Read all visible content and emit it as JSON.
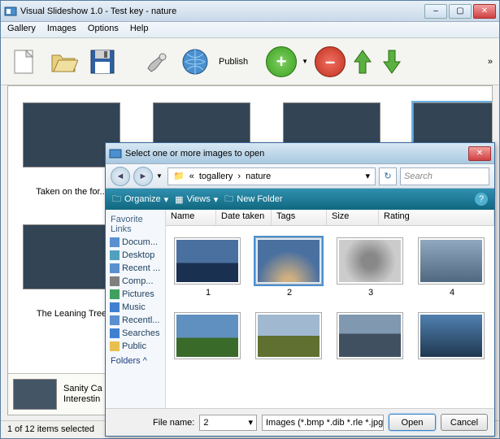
{
  "main": {
    "title": "Visual Slideshow 1.0 - Test key - nature",
    "menu": [
      "Gallery",
      "Images",
      "Options",
      "Help"
    ],
    "publish_label": "Publish",
    "thumbs": [
      {
        "caption": "Taken on the for..."
      },
      {
        "caption": ""
      },
      {
        "caption": ""
      },
      {
        "caption": ""
      }
    ],
    "second_caption": "The Leaning Tree",
    "selected_caption_1": "Sanity Ca",
    "selected_caption_2": "Interestin",
    "status": "1 of 12 items selected"
  },
  "dlg": {
    "title": "Select one or more images to open",
    "crumbs": [
      "«",
      "togallery",
      "›",
      "nature"
    ],
    "search_placeholder": "Search",
    "cmd": {
      "organize": "Organize",
      "views": "Views",
      "newfolder": "New Folder"
    },
    "favs_header": "Favorite Links",
    "favs": [
      "Docum...",
      "Desktop",
      "Recent ...",
      "Comp...",
      "Pictures",
      "Music",
      "Recentl...",
      "Searches",
      "Public"
    ],
    "folders_label": "Folders",
    "cols": {
      "name": "Name",
      "date": "Date taken",
      "tags": "Tags",
      "size": "Size",
      "rating": "Rating"
    },
    "files": [
      "1",
      "2",
      "3",
      "4"
    ],
    "filename_label": "File name:",
    "filename_value": "2",
    "filetype": "Images (*.bmp *.dib *.rle *.jpg",
    "open": "Open",
    "cancel": "Cancel"
  }
}
